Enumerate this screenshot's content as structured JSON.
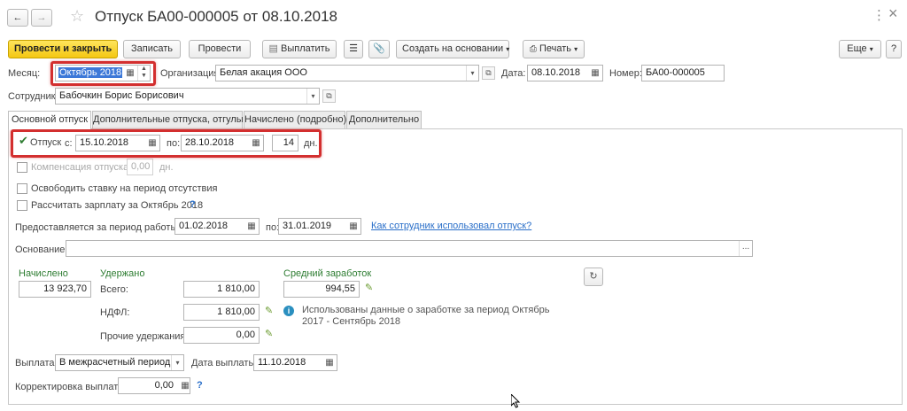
{
  "window": {
    "title": "Отпуск БА00-000005 от 08.10.2018",
    "back_icon": "arrow-left-icon",
    "forward_icon": "arrow-right-icon",
    "star_icon": "star-icon",
    "more_icon": "vertical-dots-icon",
    "close_label": "×"
  },
  "toolbar": {
    "post_close": "Провести и закрыть",
    "save": "Записать",
    "post": "Провести",
    "pay": "Выплатить",
    "create_based": "Создать на основании",
    "print": "Печать",
    "more": "Еще",
    "help": "?"
  },
  "header": {
    "month_label": "Месяц:",
    "month_value": "Октябрь 2018",
    "org_label": "Организация:",
    "org_value": "Белая акация ООО",
    "date_label": "Дата:",
    "date_value": "08.10.2018",
    "number_label": "Номер:",
    "number_value": "БА00-000005",
    "employee_label": "Сотрудник:",
    "employee_value": "Бабочкин Борис Борисович"
  },
  "tabs": [
    {
      "label": "Основной отпуск",
      "active": true
    },
    {
      "label": "Дополнительные отпуска, отгулы",
      "active": false
    },
    {
      "label": "Начислено (подробно)",
      "active": false
    },
    {
      "label": "Дополнительно",
      "active": false
    }
  ],
  "vacation": {
    "checkbox_label": "Отпуск",
    "checked": true,
    "from_label": "с:",
    "from_value": "15.10.2018",
    "to_label": "по:",
    "to_value": "28.10.2018",
    "days_value": "14",
    "days_unit": "дн."
  },
  "compensation": {
    "label": "Компенсация отпуска",
    "value": "0,00",
    "unit": "дн."
  },
  "release_rate_label": "Освободить ставку на период отсутствия",
  "calc_salary_label": "Рассчитать зарплату за Октябрь 2018",
  "work_period": {
    "label": "Предоставляется за период работы с:",
    "from_value": "01.02.2018",
    "to_label": "по:",
    "to_value": "31.01.2019",
    "link": "Как сотрудник использовал отпуск?"
  },
  "basis": {
    "label": "Основание:",
    "value": "",
    "btn": "..."
  },
  "accrued": {
    "header": "Начислено",
    "value": "13 923,70"
  },
  "withheld": {
    "header": "Удержано",
    "total_label": "Всего:",
    "total_value": "1 810,00",
    "ndfl_label": "НДФЛ:",
    "ndfl_value": "1 810,00",
    "other_label": "Прочие удержания:",
    "other_value": "0,00"
  },
  "avg_earnings": {
    "header": "Средний заработок",
    "value": "994,55",
    "info": "Использованы данные о заработке за период Октябрь 2017 - Сентябрь 2018"
  },
  "payment": {
    "label": "Выплата:",
    "value": "В межрасчетный период",
    "date_label": "Дата выплаты:",
    "date_value": "11.10.2018"
  },
  "correction": {
    "label": "Корректировка выплаты:",
    "value": "0,00"
  },
  "colors": {
    "primary_button": "#f4c713",
    "highlight_box": "#d32f2f",
    "green_header": "#2e7d32",
    "link": "#2a6fc9"
  }
}
